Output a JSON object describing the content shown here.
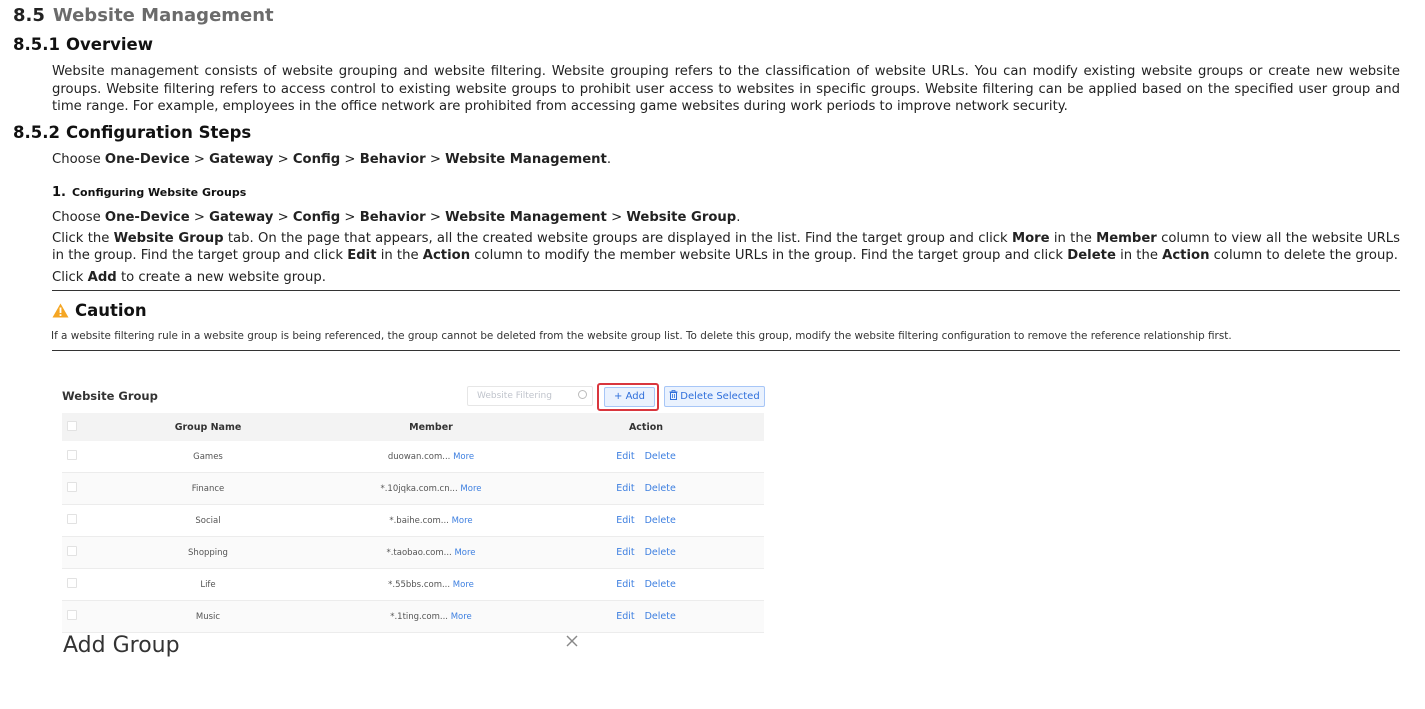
{
  "section": {
    "num": "8.5",
    "title": "Website Management"
  },
  "overview": {
    "num": "8.5.1",
    "title": "Overview",
    "text": "Website management consists of website grouping and website filtering. Website grouping refers to the classification of website URLs. You can modify existing website groups or create new website groups. Website filtering refers to access control to existing website groups to prohibit user access to websites in specific groups. Website filtering can be applied based on the specified user group and time range. For example, employees in the office network are prohibited from accessing game websites during work periods to improve network security."
  },
  "config": {
    "num": "8.5.2",
    "title": "Configuration Steps",
    "choose_prefix": "Choose",
    "path1": [
      "One-Device",
      "Gateway",
      "Config",
      "Behavior",
      "Website Management"
    ],
    "step_num": "1.",
    "step_title": "Configuring Website Groups",
    "path2": [
      "One-Device",
      "Gateway",
      "Config",
      "Behavior",
      "Website Management",
      "Website Group"
    ],
    "sep": ">",
    "period": ".",
    "p_click_1": "Click the",
    "p_website_group": "Website Group",
    "p_click_2": "tab. On the page that appears, all the created website groups are displayed in the list. Find the target group and click",
    "p_more": "More",
    "p_click_3": "in the",
    "p_member": "Member",
    "p_click_4": "column to view all the website URLs in the group. Find the target group and click",
    "p_edit": "Edit",
    "p_click_5": "in the",
    "p_action": "Action",
    "p_click_6": "column to modify the member website URLs in the group. Find the target group and click",
    "p_delete": "Delete",
    "p_click_7": "in the",
    "p_action2": "Action",
    "p_click_8": "column to delete the group.",
    "add_prefix": "Click",
    "add_bold": "Add",
    "add_suffix": "to create a new website group."
  },
  "caution": {
    "title": "Caution",
    "text": "If a website filtering rule in a website group is being referenced, the group cannot be deleted from the website group list. To delete this group, modify the website filtering configuration to remove the reference relationship first.",
    "icon": "warning-triangle-icon",
    "color": "#f5a623"
  },
  "ui": {
    "title": "Website Group",
    "search_placeholder": "Website Filtering",
    "add_label": "+ Add",
    "delete_selected_label": "Delete Selected",
    "highlight_color": "#d9363e",
    "columns": [
      "Group Name",
      "Member",
      "Action"
    ],
    "more_label": "More",
    "edit_label": "Edit",
    "delete_label": "Delete",
    "rows": [
      {
        "name": "Games",
        "member": "duowan.com..."
      },
      {
        "name": "Finance",
        "member": "*.10jqka.com.cn..."
      },
      {
        "name": "Social",
        "member": "*.baihe.com..."
      },
      {
        "name": "Shopping",
        "member": "*.taobao.com..."
      },
      {
        "name": "Life",
        "member": "*.55bbs.com..."
      },
      {
        "name": "Music",
        "member": "*.1ting.com..."
      }
    ],
    "dialog_title": "Add Group"
  }
}
